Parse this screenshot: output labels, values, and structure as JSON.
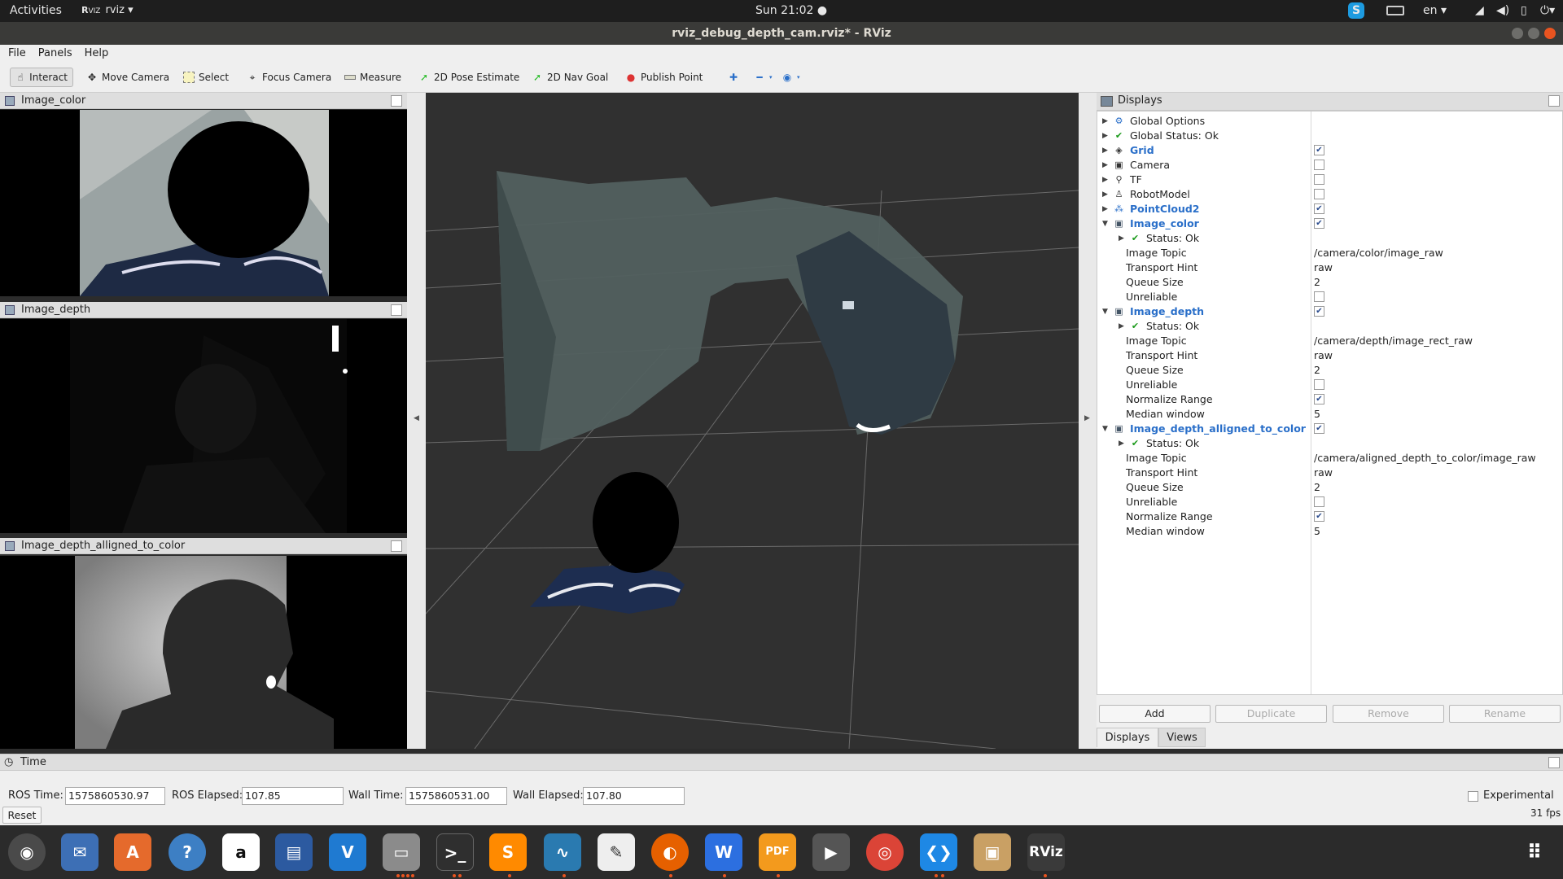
{
  "topbar": {
    "activities": "Activities",
    "app": "rviz",
    "clock": "Sun 21:02",
    "lang": "en"
  },
  "window": {
    "title": "rviz_debug_depth_cam.rviz* - RViz"
  },
  "menu": [
    "File",
    "Panels",
    "Help"
  ],
  "toolbar": {
    "interact": "Interact",
    "move_camera": "Move Camera",
    "select": "Select",
    "focus_camera": "Focus Camera",
    "measure": "Measure",
    "pose_estimate": "2D Pose Estimate",
    "nav_goal": "2D Nav Goal",
    "publish_point": "Publish Point"
  },
  "panels": {
    "image_color": "Image_color",
    "image_depth": "Image_depth",
    "image_aligned": "Image_depth_alligned_to_color"
  },
  "displays": {
    "title": "Displays",
    "rows": [
      {
        "label": "Global Options"
      },
      {
        "label": "Global Status: Ok"
      },
      {
        "label": "Grid",
        "checked": true
      },
      {
        "label": "Camera",
        "checked": false
      },
      {
        "label": "TF",
        "checked": false
      },
      {
        "label": "RobotModel",
        "checked": false
      },
      {
        "label": "PointCloud2",
        "checked": true
      },
      {
        "label": "Image_color",
        "checked": true
      },
      {
        "label": "Status: Ok"
      },
      {
        "label": "Image Topic",
        "value": "/camera/color/image_raw"
      },
      {
        "label": "Transport Hint",
        "value": "raw"
      },
      {
        "label": "Queue Size",
        "value": "2"
      },
      {
        "label": "Unreliable",
        "checked": false
      },
      {
        "label": "Image_depth",
        "checked": true
      },
      {
        "label": "Status: Ok"
      },
      {
        "label": "Image Topic",
        "value": "/camera/depth/image_rect_raw"
      },
      {
        "label": "Transport Hint",
        "value": "raw"
      },
      {
        "label": "Queue Size",
        "value": "2"
      },
      {
        "label": "Unreliable",
        "checked": false
      },
      {
        "label": "Normalize Range",
        "checked": true
      },
      {
        "label": "Median window",
        "value": "5"
      },
      {
        "label": "Image_depth_alligned_to_color",
        "checked": true
      },
      {
        "label": "Status: Ok"
      },
      {
        "label": "Image Topic",
        "value": "/camera/aligned_depth_to_color/image_raw"
      },
      {
        "label": "Transport Hint",
        "value": "raw"
      },
      {
        "label": "Queue Size",
        "value": "2"
      },
      {
        "label": "Unreliable",
        "checked": false
      },
      {
        "label": "Normalize Range",
        "checked": true
      },
      {
        "label": "Median window",
        "value": "5"
      }
    ],
    "buttons": {
      "add": "Add",
      "duplicate": "Duplicate",
      "remove": "Remove",
      "rename": "Rename"
    },
    "tabs": {
      "displays": "Displays",
      "views": "Views"
    }
  },
  "time": {
    "title": "Time",
    "ros_time_label": "ROS Time:",
    "ros_time": "1575860530.97",
    "ros_elapsed_label": "ROS Elapsed:",
    "ros_elapsed": "107.85",
    "wall_time_label": "Wall Time:",
    "wall_time": "1575860531.00",
    "wall_elapsed_label": "Wall Elapsed:",
    "wall_elapsed": "107.80",
    "experimental": "Experimental",
    "reset": "Reset",
    "fps": "31 fps"
  },
  "dock": [
    "ubuntu-icon",
    "thunderbird-icon",
    "software-icon",
    "help-icon",
    "amazon-icon",
    "writer-icon",
    "vscode-alt-icon",
    "files-icon",
    "terminal-icon",
    "sublime-icon",
    "sysmon-icon",
    "text-editor-icon",
    "firefox-icon",
    "wps-icon",
    "pdf-icon",
    "video-icon",
    "chrome-icon",
    "vscode-icon",
    "archive-icon",
    "rviz-icon"
  ],
  "dock_labels": {
    "rviz": "RViz",
    "pdf": "PDF"
  }
}
